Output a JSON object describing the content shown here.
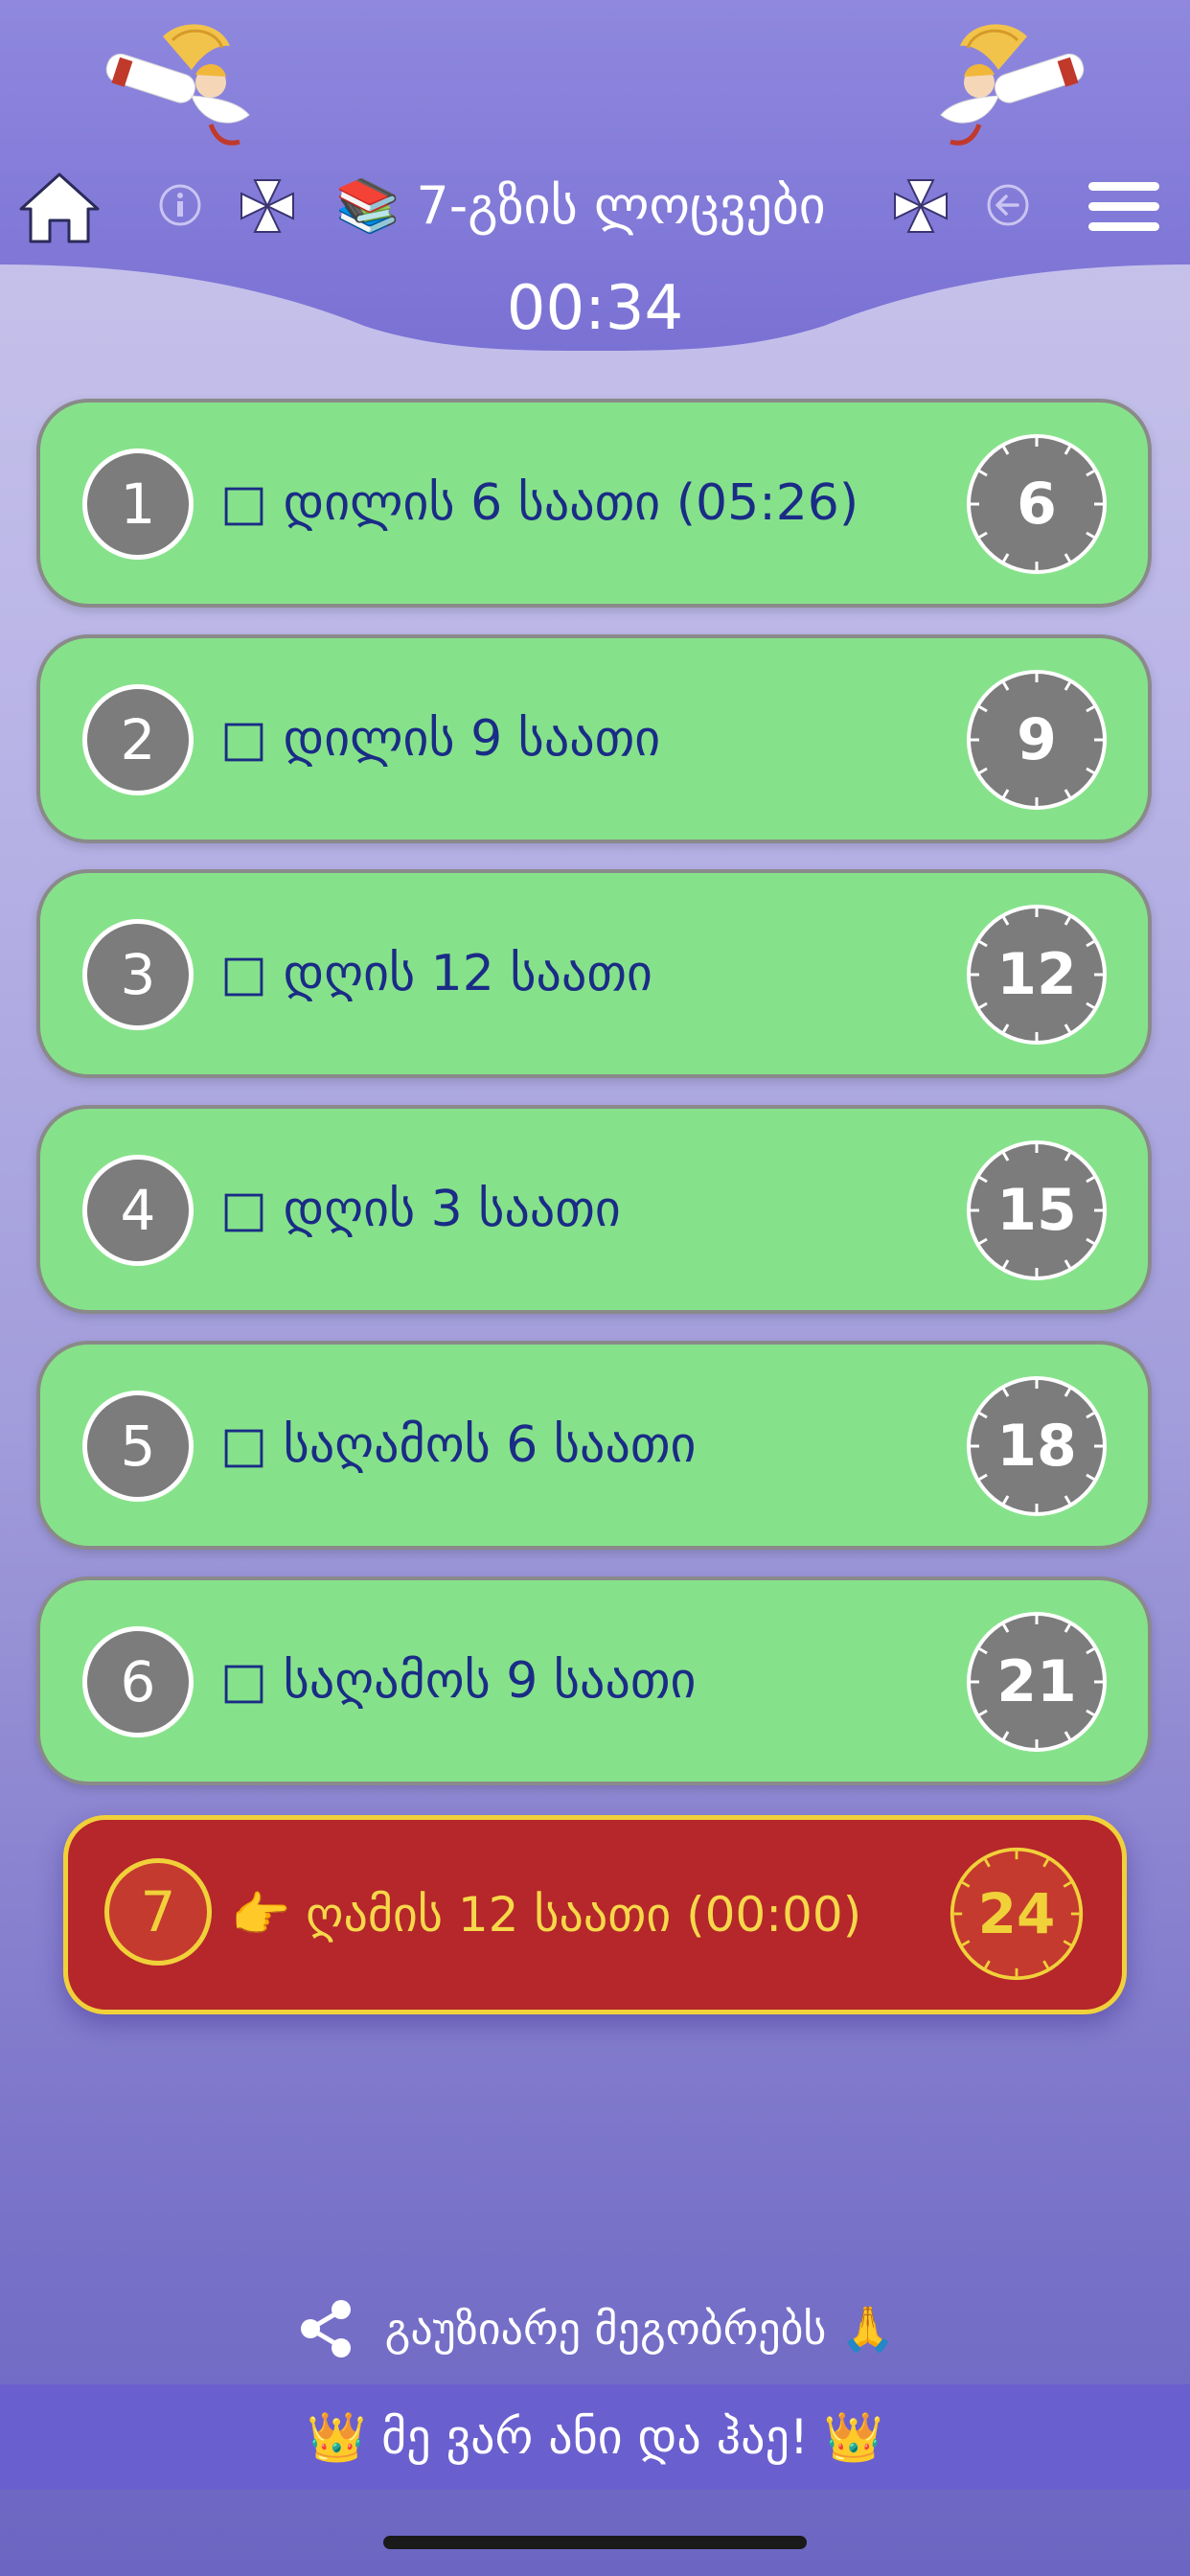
{
  "header": {
    "title_prefix_icon": "books-emoji",
    "title": "📚 7-გზის ლოცვები",
    "timer": "00:34",
    "icons": [
      "angel-trumpet-icon",
      "home-icon",
      "info-icon",
      "maltese-cross-icon",
      "back-arrow-icon",
      "hamburger-menu-icon"
    ]
  },
  "prayers": [
    {
      "index": "1",
      "label": "□ დილის 6 საათი (05:26)",
      "hour": "6",
      "active": false
    },
    {
      "index": "2",
      "label": "□ დილის 9 საათი",
      "hour": "9",
      "active": false
    },
    {
      "index": "3",
      "label": "□ დღის 12 საათი",
      "hour": "12",
      "active": false
    },
    {
      "index": "4",
      "label": "□ დღის 3 საათი",
      "hour": "15",
      "active": false
    },
    {
      "index": "5",
      "label": "□ საღამოს 6 საათი",
      "hour": "18",
      "active": false
    },
    {
      "index": "6",
      "label": "□ საღამოს 9 საათი",
      "hour": "21",
      "active": false
    },
    {
      "index": "7",
      "label": "👉 ღამის 12 საათი (00:00)",
      "hour": "24",
      "active": true
    }
  ],
  "share": {
    "label": "გაუზიარე მეგობრებს 🙏",
    "icon": "share-icon"
  },
  "footer": {
    "text": "👑 მე ვარ ანი და ჰაე! 👑"
  },
  "colors": {
    "row_bg": "#86e28a",
    "row_text": "#1a2c86",
    "active_bg": "#b5272a",
    "active_accent": "#f1d13a",
    "header_purple": "#7f76d8"
  }
}
